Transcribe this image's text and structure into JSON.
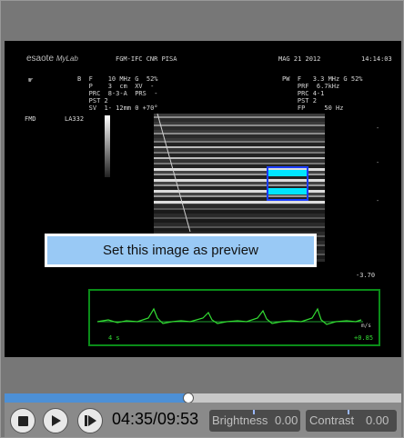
{
  "preview": {
    "label": "Set this image as preview"
  },
  "scan": {
    "logo_brand": "esaote",
    "logo_product": "MyLab",
    "institution": "FGM-IFC CNR PISA",
    "date": "MAG 21 2012",
    "time": "14:14:03",
    "bmode_params": "B  F    10 MHz G  52%\n   P    3  cm  XV  -\n   PRC  8-3-A  PRS  -\n   PST 2\n   SV  1- 12mm 0 +70°",
    "pw_params": "PW  F   3.3 MHz G 52%\n    PRF  6.7kHz\n    PRC 4-1\n    PST 2\n    FP     50 Hz",
    "mode_label": "FMD",
    "probe": "LA332",
    "scale_value": "-3.70",
    "doppler_left_label": "4 s",
    "doppler_right_top": "m/s",
    "doppler_right_bottom": "+0.85"
  },
  "controls": {
    "time_display": "04:35/09:53",
    "progress_fraction": 0.464,
    "brightness": {
      "label": "Brightness",
      "value": "0.00"
    },
    "contrast": {
      "label": "Contrast",
      "value": "0.00"
    },
    "icons": [
      "stop-icon",
      "play-icon",
      "step-forward-icon"
    ]
  },
  "colors": {
    "accent_blue": "#4d90d6",
    "preview_bg": "#99c9f5",
    "doppler_green": "#33dd33",
    "doppler_frame": "#0a8c18",
    "vessel_cyan": "#00e5ff"
  }
}
